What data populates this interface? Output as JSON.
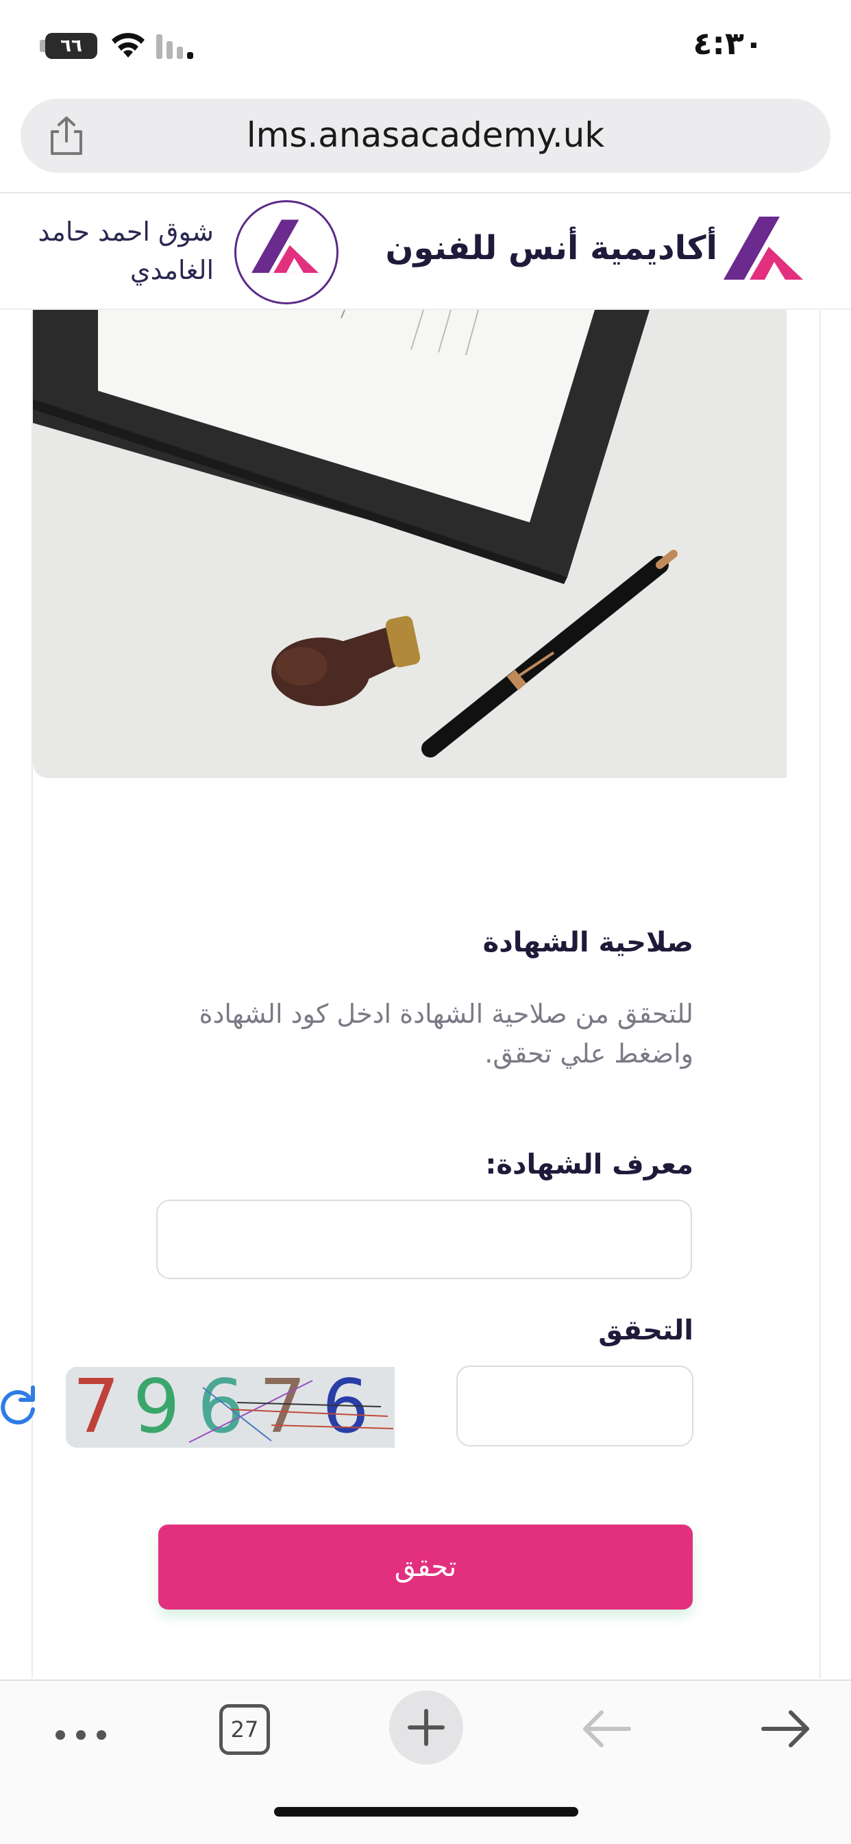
{
  "status_bar": {
    "time": "٤:٣٠",
    "battery": "٦٦"
  },
  "browser": {
    "url": "lms.anasacademy.uk",
    "tab_count": "27"
  },
  "header": {
    "brand_name": "أكاديمية أنس للفنون",
    "user_name": "شوق احمد حامد الغامدي"
  },
  "form": {
    "title": "صلاحية الشهادة",
    "description": "للتحقق من صلاحية الشهادة ادخل كود الشهادة واضغط علي تحقق.",
    "cert_label": "معرف الشهادة:",
    "cert_value": "",
    "verify_label": "التحقق",
    "captcha_value": "",
    "captcha_digits": [
      "7",
      "9",
      "6",
      "7",
      "6"
    ],
    "captcha_colors": [
      "#c0413a",
      "#3aa66b",
      "#4aa894",
      "#8a6a5a",
      "#2a3ea8"
    ],
    "submit_label": "تحقق"
  },
  "colors": {
    "accent": "#e2307f",
    "brand_purple": "#5b2a86",
    "refresh_blue": "#2f7be6"
  }
}
